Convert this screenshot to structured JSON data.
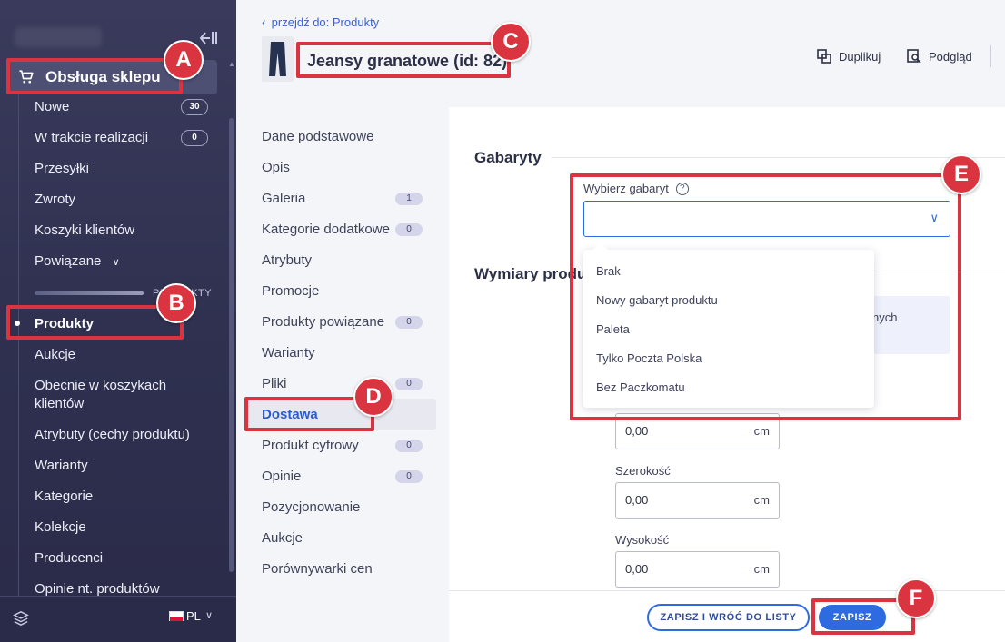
{
  "sidebar": {
    "section_header": "Obsługa sklepu",
    "items": [
      {
        "label": "Nowe",
        "badge": "30"
      },
      {
        "label": "W trakcie realizacji",
        "badge": "0"
      },
      {
        "label": "Przesyłki"
      },
      {
        "label": "Zwroty"
      },
      {
        "label": "Koszyki klientów"
      },
      {
        "label": "Powiązane"
      }
    ],
    "section_label": "PRODUKTY",
    "product_items": [
      {
        "label": "Produkty",
        "active": true
      },
      {
        "label": "Aukcje"
      },
      {
        "label": "Obecnie w koszykach"
      },
      {
        "label": "klientów"
      },
      {
        "label": "Atrybuty (cechy produktu)"
      },
      {
        "label": "Warianty"
      },
      {
        "label": "Kategorie"
      },
      {
        "label": "Kolekcje"
      },
      {
        "label": "Producenci"
      },
      {
        "label": "Opinie nt. produktów"
      }
    ],
    "language": "PL",
    "icons": [
      "cart-icon",
      "collapse-sidebar-icon",
      "layers-icon",
      "pl-flag-icon",
      "chevron-down-icon"
    ]
  },
  "header": {
    "back_link": "przejdź do: Produkty",
    "product_title": "Jeansy granatowe (id: 82)",
    "actions": {
      "duplicate": "Duplikuj",
      "preview": "Podgląd"
    }
  },
  "tabs": [
    {
      "label": "Dane podstawowe"
    },
    {
      "label": "Opis"
    },
    {
      "label": "Galeria",
      "badge": "1"
    },
    {
      "label": "Kategorie dodatkowe",
      "badge": "0"
    },
    {
      "label": "Atrybuty"
    },
    {
      "label": "Promocje"
    },
    {
      "label": "Produkty powiązane",
      "badge": "0"
    },
    {
      "label": "Warianty"
    },
    {
      "label": "Pliki",
      "badge": "0"
    },
    {
      "label": "Dostawa",
      "active": true
    },
    {
      "label": "Produkt cyfrowy",
      "badge": "0"
    },
    {
      "label": "Opinie",
      "badge": "0"
    },
    {
      "label": "Pozycjonowanie"
    },
    {
      "label": "Aukcje"
    },
    {
      "label": "Porównywarki cen"
    }
  ],
  "main": {
    "section_gabaryty": "Gabaryty",
    "select_label": "Wybierz gabaryt",
    "select_value": "",
    "dropdown_options": [
      "Brak",
      "Nowy gabaryt produktu",
      "Paleta",
      "Tylko Poczta Polska",
      "Bez Paczkomatu"
    ],
    "section_wymiary": "Wymiary produ",
    "info_text_line1": "nych",
    "dimensions": [
      {
        "label": "",
        "value": "0,00",
        "unit": "cm"
      },
      {
        "label": "Szerokość",
        "value": "0,00",
        "unit": "cm"
      },
      {
        "label": "Wysokość",
        "value": "0,00",
        "unit": "cm"
      }
    ]
  },
  "footer": {
    "save_and_return": "ZAPISZ I WRÓĆ DO LISTY",
    "save": "ZAPISZ"
  },
  "annotations": {
    "markers": [
      "A",
      "B",
      "C",
      "D",
      "E",
      "F"
    ],
    "color": "#d9343f"
  },
  "colors": {
    "accent": "#2f6be0",
    "sidebar_bg": "#2f3050",
    "annotation": "#d9343f"
  }
}
